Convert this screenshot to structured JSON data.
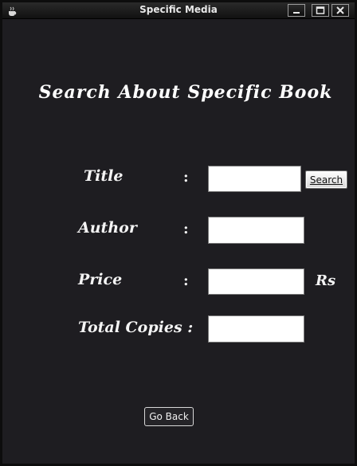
{
  "window": {
    "title": "Specific Media",
    "controls": {
      "minimize": "minimize-icon",
      "maximize": "maximize-icon",
      "close": "close-icon"
    }
  },
  "form": {
    "heading": "Search About Specific Book",
    "title_label": "Title",
    "author_label": "Author",
    "price_label": "Price",
    "copies_label": "Total Copies :",
    "colon": ":",
    "title_value": "",
    "author_value": "",
    "price_value": "",
    "copies_value": "",
    "search_button": "Search",
    "currency": "Rs",
    "back_button": "Go Back"
  },
  "colors": {
    "background": "#1e1d21",
    "text": "#ffffff",
    "field": "#ffffff"
  }
}
